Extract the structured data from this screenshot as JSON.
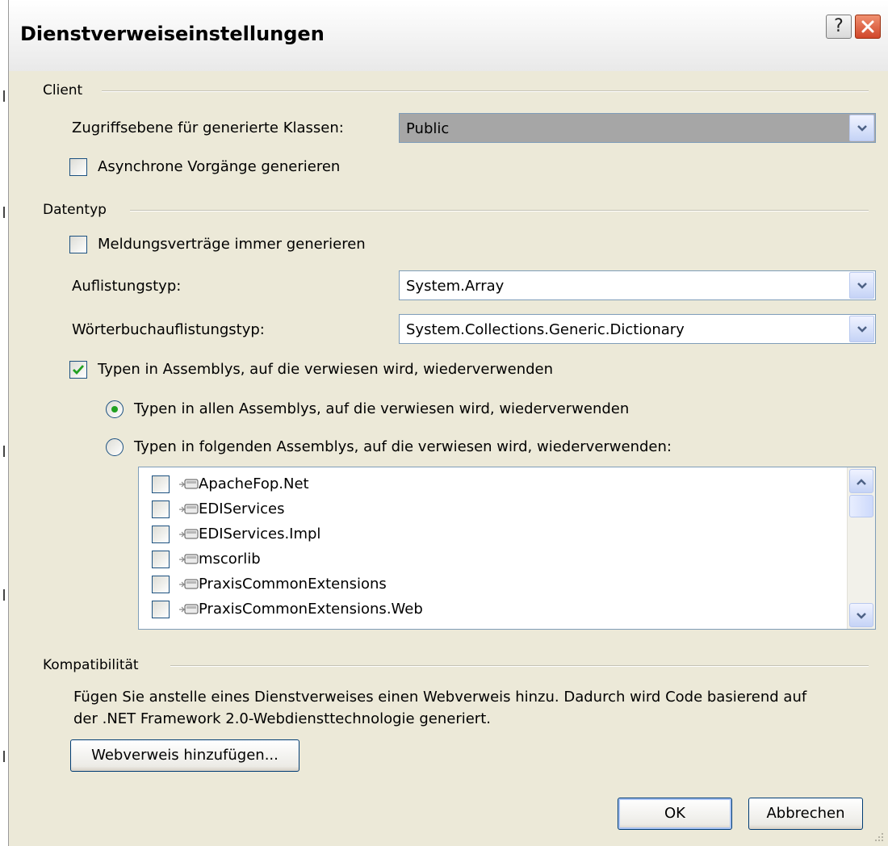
{
  "window": {
    "title": "Dienstverweiseinstellungen",
    "help_symbol": "?"
  },
  "client": {
    "heading": "Client",
    "access_level_label": "Zugriffsebene für generierte Klassen:",
    "access_level_value": "Public",
    "async_label": "Asynchrone Vorgänge generieren",
    "async_checked": false
  },
  "datatype": {
    "heading": "Datentyp",
    "message_contracts_label": "Meldungsverträge immer generieren",
    "message_contracts_checked": false,
    "collection_label": "Auflistungstyp:",
    "collection_value": "System.Array",
    "dictionary_label": "Wörterbuchauflistungstyp:",
    "dictionary_value": "System.Collections.Generic.Dictionary",
    "reuse_label": "Typen in Assemblys, auf die verwiesen wird, wiederverwenden",
    "reuse_checked": true,
    "reuse_all_label": "Typen in allen Assemblys, auf die verwiesen wird, wiederverwenden",
    "reuse_all_selected": true,
    "reuse_specific_label": "Typen in folgenden Assemblys, auf die verwiesen wird, wiederverwenden:",
    "reuse_specific_selected": false,
    "assemblies": [
      {
        "label": "ApacheFop.Net",
        "checked": false
      },
      {
        "label": "EDIServices",
        "checked": false
      },
      {
        "label": "EDIServices.Impl",
        "checked": false
      },
      {
        "label": "mscorlib",
        "checked": false
      },
      {
        "label": "PraxisCommonExtensions",
        "checked": false
      },
      {
        "label": "PraxisCommonExtensions.Web",
        "checked": false
      }
    ]
  },
  "compatibility": {
    "heading": "Kompatibilität",
    "description_line1": "Fügen Sie anstelle eines Dienstverweises einen Webverweis hinzu. Dadurch wird Code basierend auf",
    "description_line2": "der .NET Framework 2.0-Webdiensttechnologie generiert.",
    "add_web_reference_label": "Webverweis hinzufügen..."
  },
  "footer": {
    "ok_label": "OK",
    "cancel_label": "Abbrechen"
  },
  "colors": {
    "dialog_background": "#ece9d8",
    "check_green": "#21a121",
    "field_border": "#7f9db9",
    "button_border": "#003c74"
  }
}
